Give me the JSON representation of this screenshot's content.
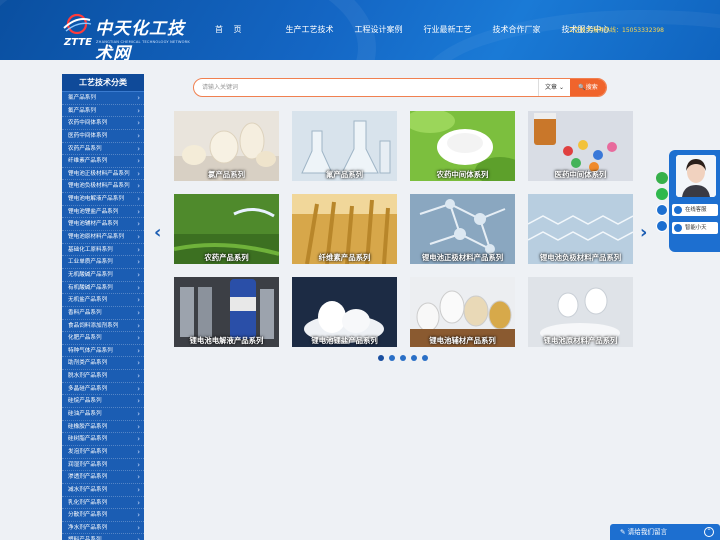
{
  "header": {
    "logo_title": "中天化工技术网",
    "logo_abbr": "ZTTE",
    "logo_sub": "ZHANGTIAN CHEMICAL TECHNOLOGY NETWORK",
    "nav": [
      "首 页",
      "生产工艺技术",
      "工程设计案例",
      "行业最新工艺",
      "技术合作厂家",
      "技术服务中心"
    ],
    "hotline": "工艺技术服务热线：15053332398"
  },
  "sidebar": {
    "title": "工艺技术分类",
    "items": [
      "氯产品系列",
      "氟产品系列",
      "农药中间体系列",
      "医药中间体系列",
      "农药产品系列",
      "纤维素产品系列",
      "锂电池正极材料产品系列",
      "锂电池负极材料产品系列",
      "锂电池电解液产品系列",
      "锂电池锂盐产品系列",
      "锂电池辅材产品系列",
      "锂电池原材料产品系列",
      "基础化工原料系列",
      "工业单质产品系列",
      "无机酸碱产品系列",
      "有机酸碱产品系列",
      "无机盐产品系列",
      "香料产品系列",
      "食品饲料添加剂系列",
      "化肥产品系列",
      "特种气体产品系列",
      "助剂类产品系列",
      "脱水剂产品系列",
      "多晶硅产品系列",
      "硅烷产品系列",
      "硅油产品系列",
      "硅橡胶产品系列",
      "硅树脂产品系列",
      "发泡剂产品系列",
      "润湿剂产品系列",
      "渗透剂产品系列",
      "减水剂产品系列",
      "乳化剂产品系列",
      "分散剂产品系列",
      "净水剂产品系列",
      "塑料产品系列"
    ]
  },
  "search": {
    "placeholder": "请输入关键词",
    "select": "文章",
    "button": "搜索"
  },
  "products": [
    "氯产品系列",
    "氟产品系列",
    "农药中间体系列",
    "医药中间体系列",
    "农药产品系列",
    "纤维素产品系列",
    "锂电池正极材料产品系列",
    "锂电池负极材料产品系列",
    "锂电池电解液产品系列",
    "锂电池锂盐产品系列",
    "锂电池辅材产品系列",
    "锂电池原材料产品系列"
  ],
  "float": {
    "online": "在线客服",
    "wechat": "智能小天"
  },
  "msgbar": {
    "label": "请给我们留言"
  },
  "colors": {
    "brand": "#1b5db3",
    "accent": "#f0642c",
    "hotline": "#ffd84d"
  }
}
